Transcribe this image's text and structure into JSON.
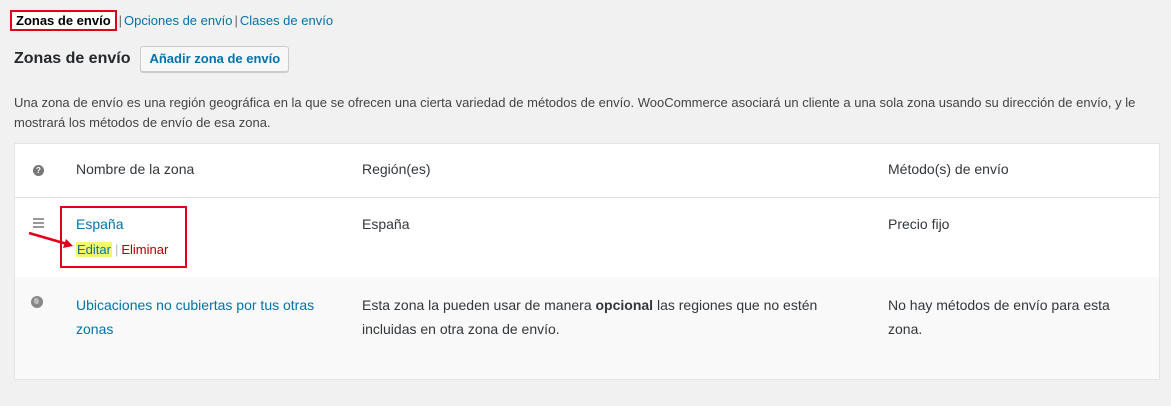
{
  "subnav": {
    "items": [
      "Zonas de envío",
      "Opciones de envío",
      "Clases de envío"
    ],
    "separator": "|"
  },
  "heading": {
    "title": "Zonas de envío",
    "add_button": "Añadir zona de envío"
  },
  "description": "Una zona de envío es una región geográfica en la que se ofrecen una cierta variedad de métodos de envío. WooCommerce asociará un cliente a una sola zona usando su dirección de envío, y le mostrará los métodos de envío de esa zona.",
  "table": {
    "headers": {
      "help_icon": "help-icon",
      "name": "Nombre de la zona",
      "region": "Región(es)",
      "method": "Método(s) de envío"
    },
    "zones": [
      {
        "name": "España",
        "region": "España",
        "method": "Precio fijo",
        "actions": {
          "edit": "Editar",
          "separator": "|",
          "delete": "Eliminar"
        }
      }
    ],
    "rest_of_world": {
      "name": "Ubicaciones no cubiertas por tus otras zonas",
      "region_before": "Esta zona la pueden usar de manera",
      "region_strong": "opcional",
      "region_after": "las regiones que no estén incluidas en otra zona de envío.",
      "method": "No hay métodos de envío para esta zona."
    }
  },
  "colors": {
    "link": "#0073aa",
    "delete": "#aa0000",
    "annotation": "#e0001a",
    "highlight": "#f4f86a"
  }
}
